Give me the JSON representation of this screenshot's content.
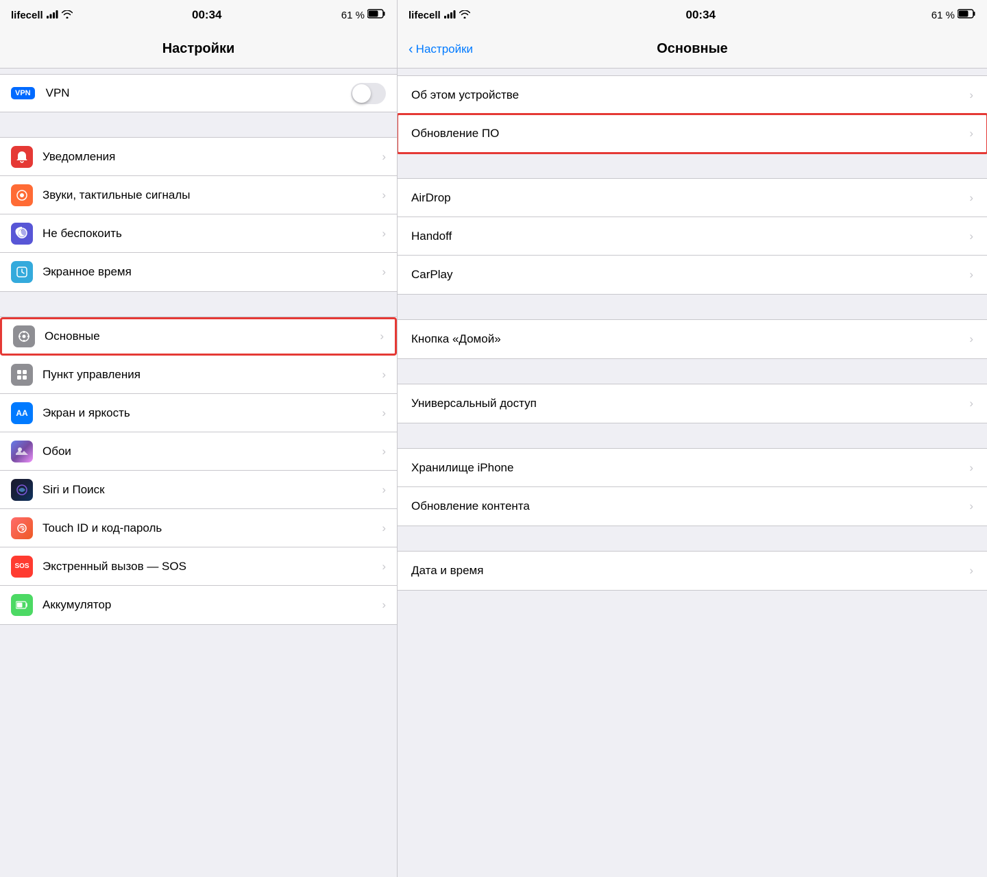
{
  "left_status": {
    "carrier": "lifecell",
    "wifi": "▾",
    "time": "00:34",
    "battery_percent": "61 %"
  },
  "right_status": {
    "carrier": "lifecell",
    "wifi": "▾",
    "time": "00:34",
    "battery_percent": "61 %"
  },
  "left_panel": {
    "title": "Настройки",
    "vpn_label": "VPN",
    "sections": [
      {
        "items": [
          {
            "icon": "🔔",
            "color": "icon-red",
            "label": "Уведомления"
          },
          {
            "icon": "🔊",
            "color": "icon-orange",
            "label": "Звуки, тактильные сигналы"
          },
          {
            "icon": "🌙",
            "color": "icon-purple",
            "label": "Не беспокоить"
          },
          {
            "icon": "⏱",
            "color": "icon-indigo",
            "label": "Экранное время"
          }
        ]
      },
      {
        "items": [
          {
            "icon": "⚙️",
            "color": "icon-gray",
            "label": "Основные",
            "highlighted": true
          },
          {
            "icon": "⊞",
            "color": "icon-gray",
            "label": "Пункт управления"
          },
          {
            "icon": "AA",
            "color": "icon-aa",
            "label": "Экран и яркость"
          },
          {
            "icon": "✦",
            "color": "icon-wallpaper",
            "label": "Обои"
          },
          {
            "icon": "◉",
            "color": "icon-siri",
            "label": "Siri и Поиск"
          },
          {
            "icon": "◈",
            "color": "icon-pink",
            "label": "Touch ID и код-пароль"
          },
          {
            "icon": "SOS",
            "color": "icon-sos",
            "label": "Экстренный вызов — SOS"
          },
          {
            "icon": "🔋",
            "color": "icon-battery",
            "label": "Аккумулятор"
          }
        ]
      }
    ]
  },
  "right_panel": {
    "back_label": "Настройки",
    "title": "Основные",
    "groups": [
      {
        "items": [
          {
            "label": "Об этом устройстве"
          },
          {
            "label": "Обновление ПО",
            "highlighted": true
          }
        ]
      },
      {
        "items": [
          {
            "label": "AirDrop"
          },
          {
            "label": "Handoff"
          },
          {
            "label": "CarPlay"
          }
        ]
      },
      {
        "items": [
          {
            "label": "Кнопка «Домой»"
          }
        ]
      },
      {
        "items": [
          {
            "label": "Универсальный доступ"
          }
        ]
      },
      {
        "items": [
          {
            "label": "Хранилище iPhone"
          },
          {
            "label": "Обновление контента"
          }
        ]
      },
      {
        "items": [
          {
            "label": "Дата и время"
          }
        ]
      }
    ]
  }
}
